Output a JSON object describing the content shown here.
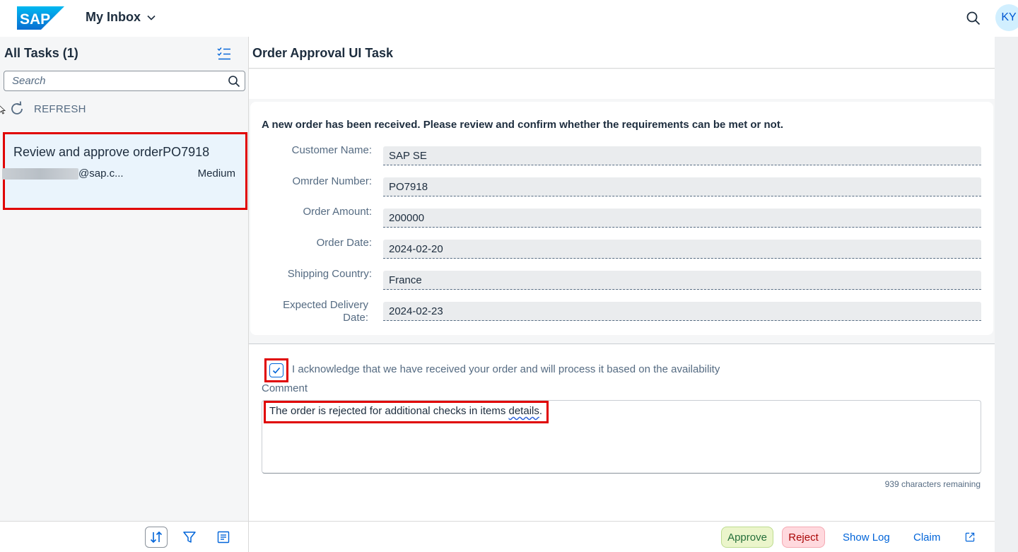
{
  "header": {
    "logo_text": "SAP",
    "app_title": "My Inbox",
    "user_initials": "KY"
  },
  "master": {
    "title": "All Tasks (1)",
    "search_placeholder": "Search",
    "refresh_label": "REFRESH",
    "tasks": [
      {
        "title": "Review and approve orderPO7918",
        "email": "@sap.c...",
        "priority": "Medium"
      }
    ]
  },
  "detail": {
    "title": "Order Approval UI Task",
    "form_heading": "A new order has been received. Please review and confirm whether the requirements can be met or not.",
    "fields": [
      {
        "label": "Customer Name:",
        "value": "SAP SE"
      },
      {
        "label": "Omrder Number:",
        "value": "PO7918"
      },
      {
        "label": "Order Amount:",
        "value": "200000"
      },
      {
        "label": "Order Date:",
        "value": "2024-02-20"
      },
      {
        "label": "Shipping Country:",
        "value": "France"
      },
      {
        "label": "Expected Delivery Date:",
        "value": "2024-02-23"
      }
    ],
    "acknowledge_text": "I acknowledge that we have received your order and will process it based on the availability",
    "acknowledge_checked": true,
    "comment_label": "Comment",
    "comment_text_main": "The order is rejected for additional checks in items ",
    "comment_text_spell": "details",
    "comment_text_end": ".",
    "chars_remaining": "939 characters remaining"
  },
  "footer": {
    "approve_label": "Approve",
    "reject_label": "Reject",
    "show_log_label": "Show Log",
    "claim_label": "Claim"
  },
  "colors": {
    "brand_blue": "#0a6ed1",
    "highlight_red": "#e00000",
    "approve_bg": "#ebf5cb",
    "reject_bg": "#ffd9de",
    "link_blue": "#0064d9"
  },
  "icons": {
    "header_search": "search-icon",
    "multi_select": "multi-select-icon",
    "refresh": "refresh-icon",
    "sort": "sort-icon",
    "filter": "filter-icon",
    "group": "group-icon",
    "open_new": "open-new-window-icon",
    "checkbox_check": "checkmark-icon"
  }
}
